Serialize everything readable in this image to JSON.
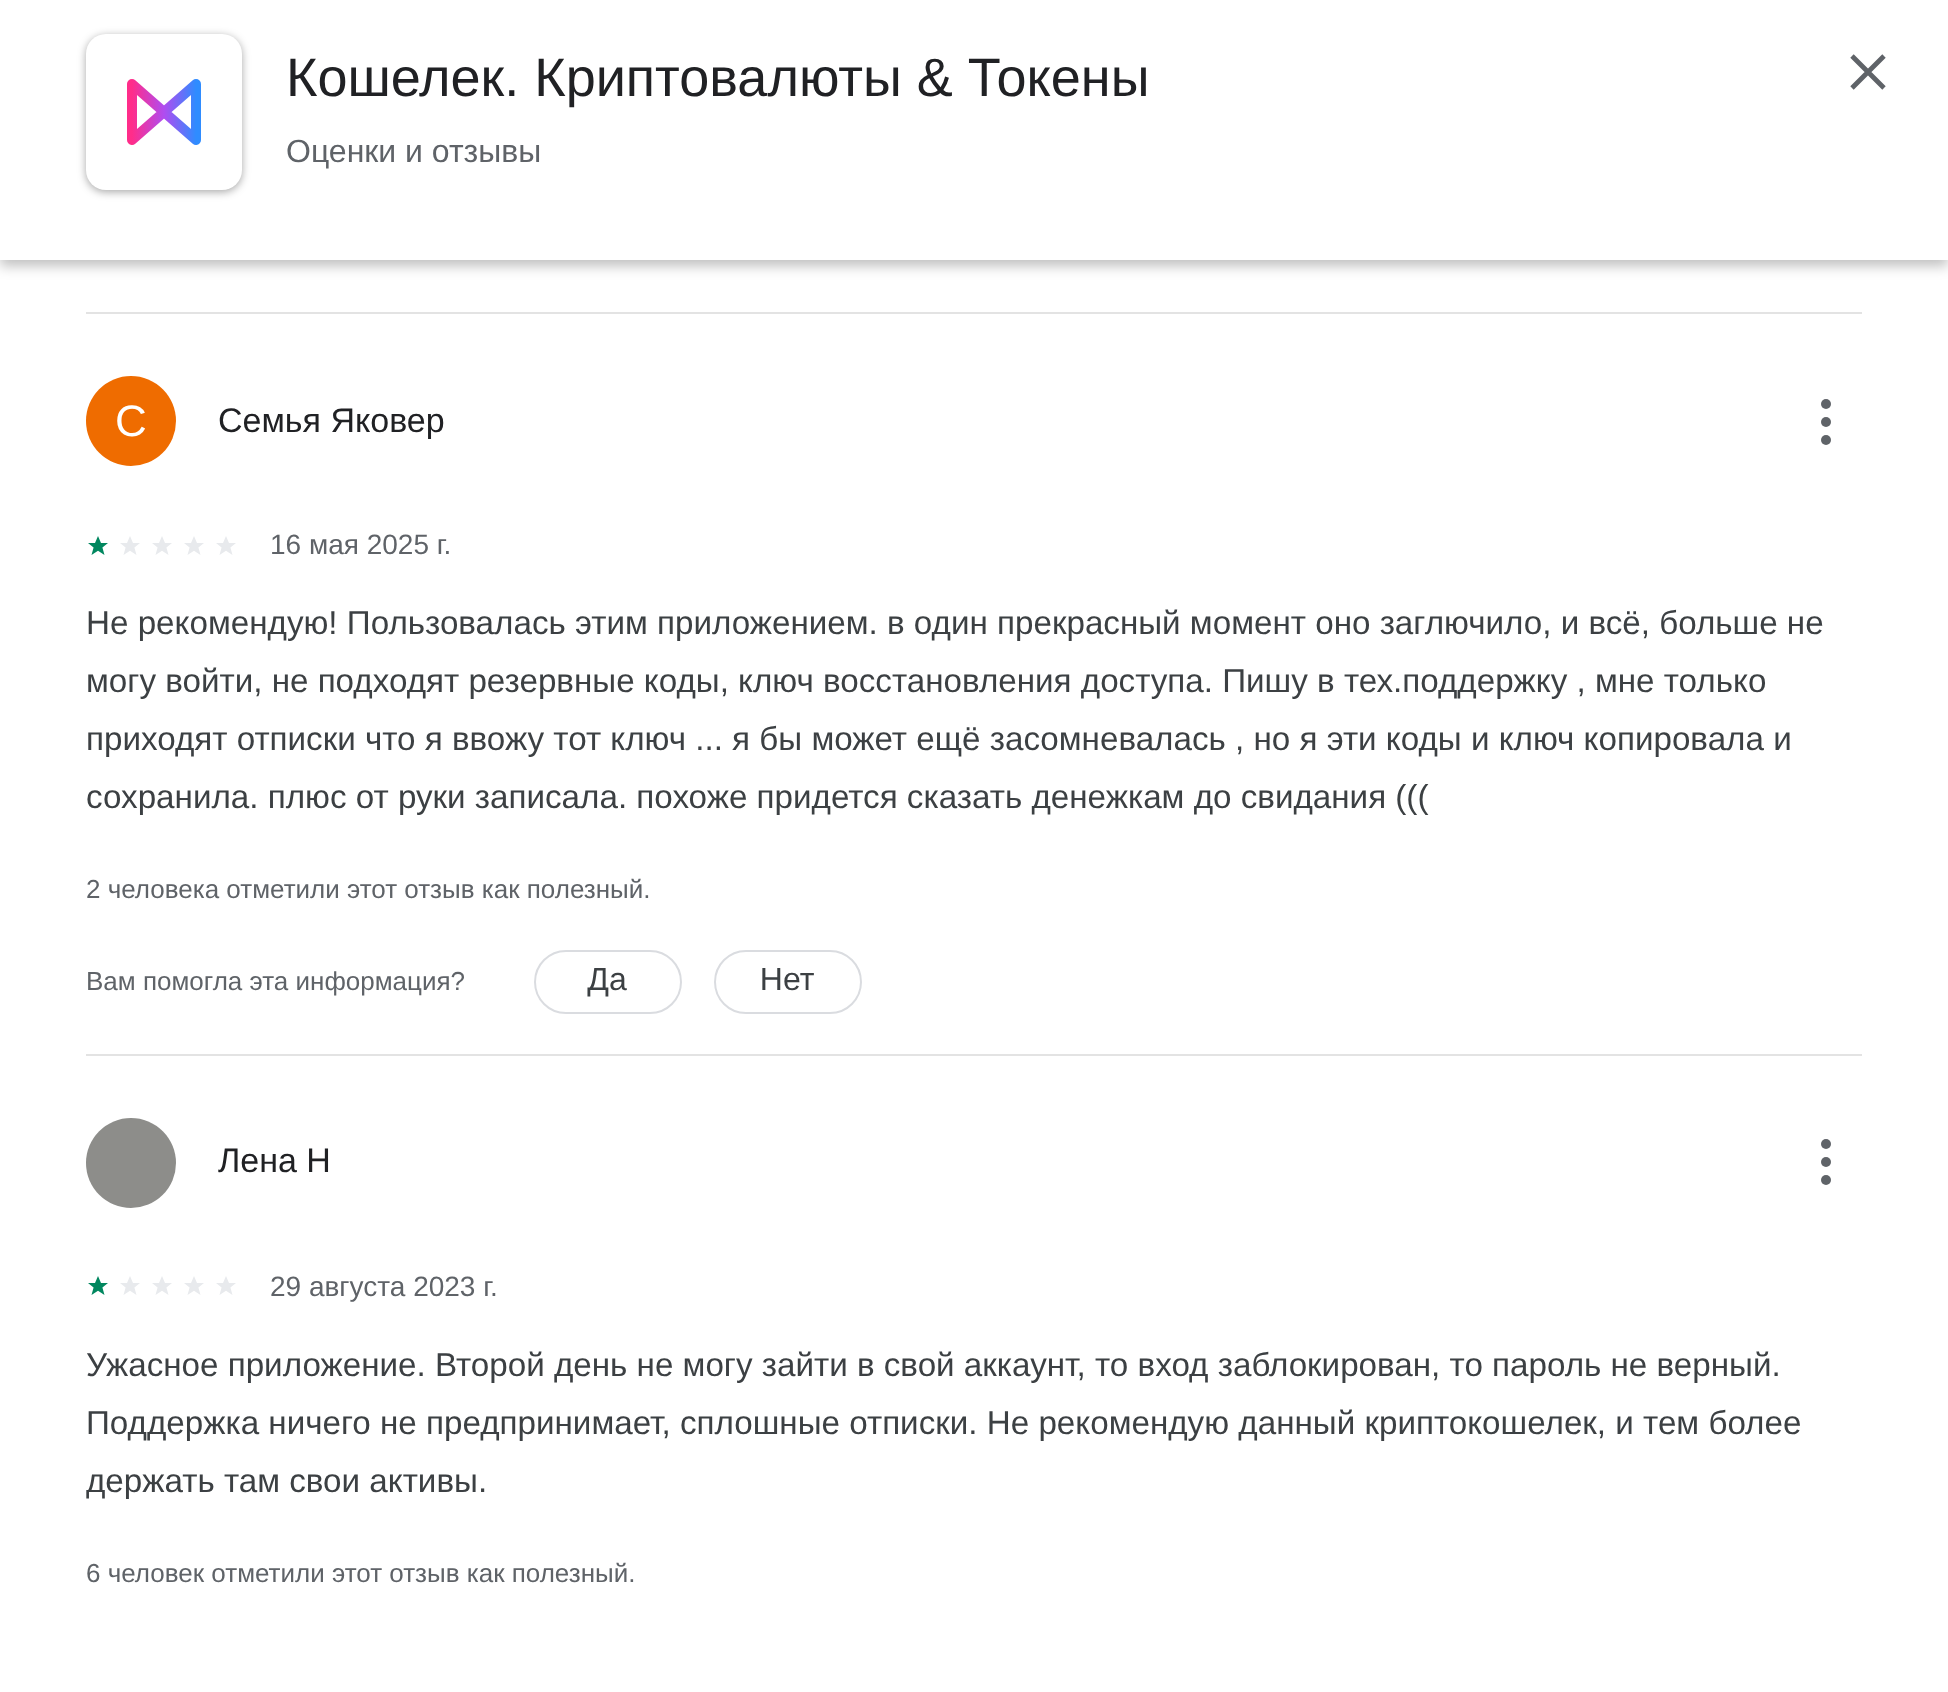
{
  "header": {
    "title": "Кошелек. Криптовалюты & Токены",
    "subtitle": "Оценки и отзывы"
  },
  "reviews": [
    {
      "author": "Семья Яковер",
      "avatar": {
        "kind": "letter",
        "letter": "С",
        "color": "#ef6c00"
      },
      "stars": 1,
      "date": "16 мая 2025 г.",
      "text": "Не рекомендую! Пользовалась этим приложением. в один прекрасный момент оно заглючило, и всё, больше не могу войти, не подходят резервные коды, ключ восстановления доступа. Пишу в тех.поддержку , мне только приходят отписки что я ввожу тот ключ ... я бы может ещё засомневалась , но я эти коды и ключ копировала и сохранила. плюс от руки записала. похоже придется сказать денежкам до свидания (((",
      "helpful_count": "2 человека отметили этот отзыв как полезный.",
      "feedback": {
        "question": "Вам помогла эта информация?",
        "buttons": [
          "Да",
          "Нет"
        ]
      }
    },
    {
      "author": "Лена Н",
      "avatar": {
        "kind": "plain",
        "color": "#8d8d8a"
      },
      "stars": 1,
      "date": "29 августа 2023 г.",
      "text": "Ужасное приложение. Второй день не могу зайти в свой аккаунт, то вход заблокирован, то пароль не верный. Поддержка ничего не предпринимает, сплошные отписки. Не рекомендую данный криптокошелек, и тем более держать там свои активы.",
      "helpful_count": "6 человек отметили этот отзыв как полезный."
    }
  ]
}
